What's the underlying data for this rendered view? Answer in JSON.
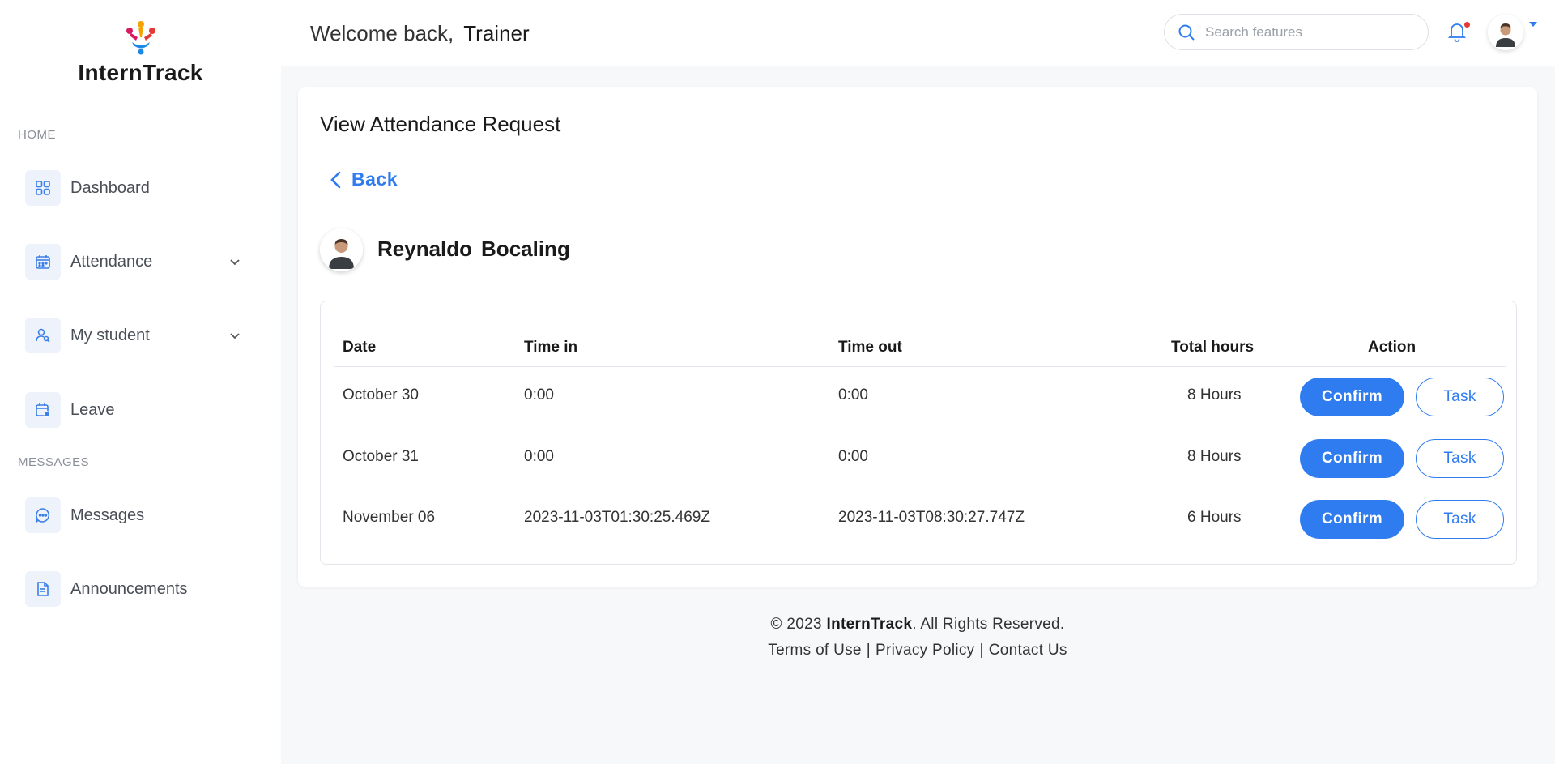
{
  "brand": {
    "name": "InternTrack",
    "logo_icon": "brand-logo-icon"
  },
  "sidebar": {
    "sections": [
      {
        "label": "HOME"
      },
      {
        "label": "MESSAGES"
      }
    ],
    "items": [
      {
        "label": "Dashboard",
        "icon": "grid-icon"
      },
      {
        "label": "Attendance",
        "icon": "calendar-icon",
        "expandable": true
      },
      {
        "label": "My student",
        "icon": "user-search-icon",
        "expandable": true
      },
      {
        "label": "Leave",
        "icon": "calendar-clock-icon"
      },
      {
        "label": "Messages",
        "icon": "chat-icon"
      },
      {
        "label": "Announcements",
        "icon": "document-icon"
      }
    ]
  },
  "header": {
    "welcome": "Welcome back,",
    "user_name": "Trainer",
    "search_placeholder": "Search features",
    "notification_icon": "bell-icon",
    "has_unread": true
  },
  "page": {
    "title": "View Attendance Request",
    "back_label": "Back",
    "student": {
      "first_name": "Reynaldo",
      "last_name": "Bocaling"
    }
  },
  "table": {
    "headers": [
      "Date",
      "Time in",
      "Time out",
      "Total hours",
      "Action"
    ],
    "rows": [
      {
        "date": "October 30",
        "time_in": "0:00",
        "time_out": "0:00",
        "total": "8 Hours"
      },
      {
        "date": "October 31",
        "time_in": "0:00",
        "time_out": "0:00",
        "total": "8 Hours"
      },
      {
        "date": "November 06",
        "time_in": "2023-11-03T01:30:25.469Z",
        "time_out": "2023-11-03T08:30:27.747Z",
        "total": "6 Hours"
      }
    ],
    "confirm_label": "Confirm",
    "task_label": "Task"
  },
  "footer": {
    "copyright_prefix": "© 2023",
    "brand": "InternTrack",
    "copyright_suffix": ". All Rights Reserved.",
    "links": [
      "Terms of Use",
      "Privacy Policy",
      "Contact Us"
    ],
    "separator": "|"
  },
  "colors": {
    "accent": "#2f7cf0",
    "sidebar_bg": "#ffffff",
    "page_bg": "#f7f8fa",
    "icon_box": "#edf2fb"
  }
}
